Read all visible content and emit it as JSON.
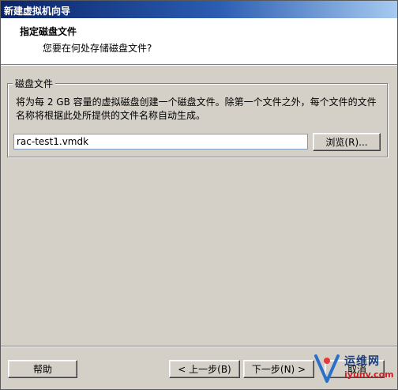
{
  "window": {
    "title": "新建虚拟机向导"
  },
  "header": {
    "title": "指定磁盘文件",
    "subtitle": "您要在何处存储磁盘文件?"
  },
  "disk_file": {
    "group_label": "磁盘文件",
    "description": "将为每 2 GB 容量的虚拟磁盘创建一个磁盘文件。除第一个文件之外，每个文件的文件名称将根据此处所提供的文件名称自动生成。",
    "path_value": "rac-test1.vmdk",
    "browse_label": "浏览(R)..."
  },
  "footer": {
    "help_label": "帮助",
    "back_label": "< 上一步(B)",
    "next_label": "下一步(N) >",
    "cancel_label": "取消"
  },
  "watermark": {
    "text_top": "运维网",
    "text_bottom": "iyunv.com",
    "icon": "iyunv-logo-icon"
  },
  "colors": {
    "dialog_bg": "#d4d0c8",
    "title_gradient_start": "#0a246a",
    "title_gradient_end": "#a6caf0"
  }
}
